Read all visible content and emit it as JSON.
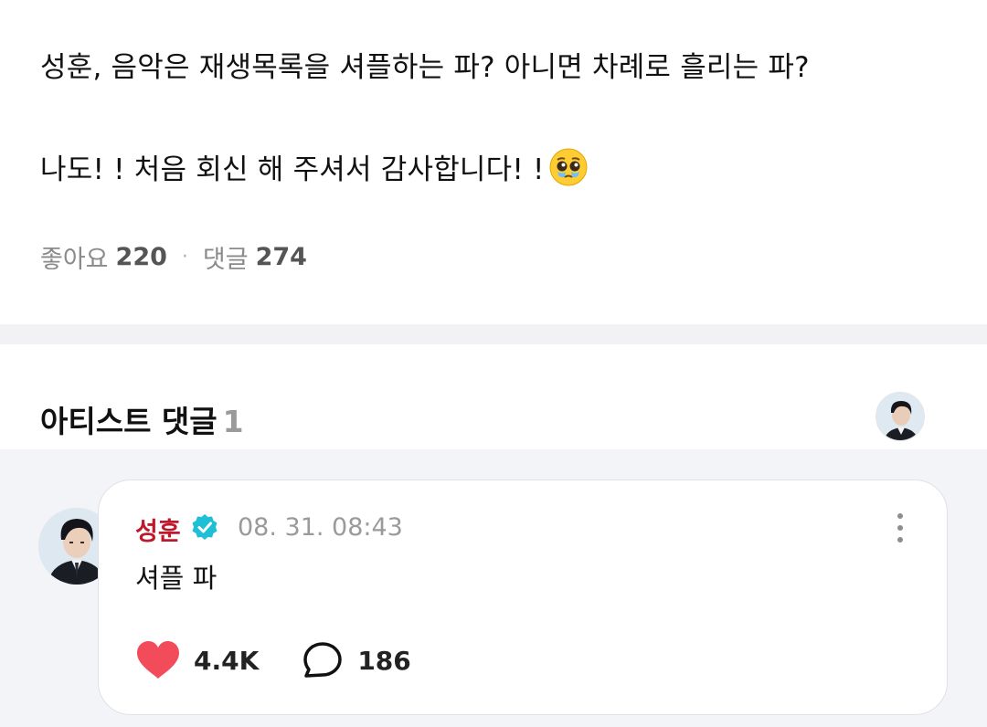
{
  "post": {
    "question": "성훈, 음악은 재생목록을 셔플하는 파? 아니면 차례로 흘리는 파?",
    "reply_text": "나도! ! 처음 회신 해 주셔서 감사합니다! !",
    "emoji": "pleading-face-emoji",
    "likes_label": "좋아요",
    "likes_count": "220",
    "separator": "·",
    "comments_label": "댓글",
    "comments_count": "274"
  },
  "artist_comments": {
    "title": "아티스트 댓글",
    "count": "1"
  },
  "comment": {
    "author": "성훈",
    "verified_icon": "verified-badge-icon",
    "timestamp": "08. 31. 08:43",
    "text": "셔플 파",
    "likes": "4.4K",
    "replies": "186"
  },
  "colors": {
    "author": "#c0182b",
    "heart": "#f24b5a",
    "verified": "#1fbfd6",
    "background_alt": "#f3f4f8"
  }
}
